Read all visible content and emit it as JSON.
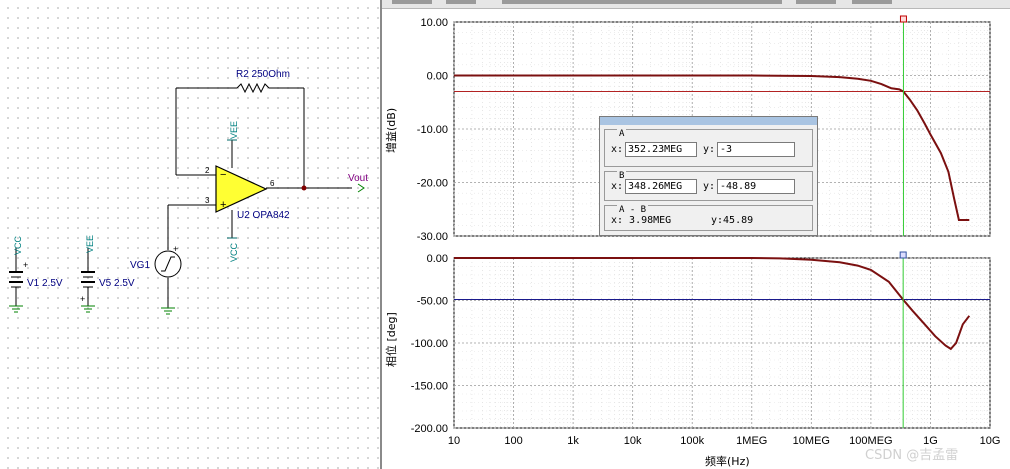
{
  "schematic": {
    "r2_label": "R2 250Ohm",
    "u2_label": "U2 OPA842",
    "vee_top": "VEE",
    "vcc_bottom": "VCC",
    "vout_label": "Vout",
    "pin2": "2",
    "pin3": "3",
    "pin6": "6",
    "vg1_label": "VG1",
    "v1_label": "V1 2.5V",
    "v1_net": "VCC",
    "v5_label": "V5 2.5V",
    "v5_net": "VEE"
  },
  "analyzer": {
    "gain_ylabel": "增益(dB)",
    "phase_ylabel": "相位 [deg]",
    "xlabel": "频率(Hz)",
    "watermark": "CSDN @吉孟雷",
    "gain_ticks": [
      "10.00",
      "0.00",
      "-10.00",
      "-20.00",
      "-30.00"
    ],
    "phase_ticks": [
      "0.00",
      "-50.00",
      "-100.00",
      "-150.00",
      "-200.00"
    ],
    "x_ticks": [
      "10",
      "100",
      "1k",
      "10k",
      "100k",
      "1MEG",
      "10MEG",
      "100MEG",
      "1G",
      "10G"
    ]
  },
  "cursor_box": {
    "a_label": "A",
    "a_x_label": "x:",
    "a_x": "352.23MEG",
    "a_y_label": "y:",
    "a_y": "-3",
    "b_label": "B",
    "b_x_label": "x:",
    "b_x": "348.26MEG",
    "b_y_label": "y:",
    "b_y": "-48.89",
    "diff_label": "A - B",
    "diff_x": "x: 3.98MEG",
    "diff_y": "y:45.89"
  },
  "chart_data": [
    {
      "type": "line",
      "ylabel": "增益(dB)",
      "xlabel": "",
      "x_scale": "log",
      "xlim": [
        10,
        10000000000
      ],
      "ylim": [
        -30,
        10
      ],
      "grid": true,
      "series": [
        {
          "x": [
            10,
            1000000,
            10000000,
            30000000,
            60000000,
            100000000,
            150000000,
            220000000,
            300000000,
            352000000,
            450000000,
            600000000,
            800000000,
            1000000000,
            1500000000,
            2000000000,
            2500000000,
            3000000000,
            4500000000
          ],
          "y": [
            0,
            0,
            -0.1,
            -0.3,
            -0.6,
            -1.0,
            -1.6,
            -2.4,
            -2.6,
            -3.0,
            -4.5,
            -6.5,
            -9.0,
            -11.0,
            -14.5,
            -18.0,
            -23.0,
            -27.0,
            -27.0
          ]
        }
      ],
      "reference_lines": [
        {
          "axis": "y",
          "value": -3,
          "color": "#b22222"
        }
      ],
      "cursor_x": 352230000,
      "colors": {
        "trace": "#7b1010",
        "cursor": "#33cc33"
      }
    },
    {
      "type": "line",
      "ylabel": "相位 [deg]",
      "xlabel": "频率(Hz)",
      "x_scale": "log",
      "xlim": [
        10,
        10000000000
      ],
      "ylim": [
        -200,
        0
      ],
      "grid": true,
      "series": [
        {
          "x": [
            10,
            1000000,
            3000000,
            10000000,
            30000000,
            60000000,
            100000000,
            200000000,
            348000000,
            500000000,
            800000000,
            1200000000,
            1800000000,
            2200000000,
            2700000000,
            3500000000,
            4500000000
          ],
          "y": [
            0,
            0,
            -0.5,
            -2,
            -5,
            -9,
            -14,
            -28,
            -49,
            -62,
            -78,
            -92,
            -103,
            -107,
            -100,
            -78,
            -68
          ]
        }
      ],
      "reference_lines": [
        {
          "axis": "y",
          "value": -48.89,
          "color": "#1a1a8c"
        }
      ],
      "cursor_x": 348260000,
      "colors": {
        "trace": "#7b1010",
        "cursor": "#33cc33"
      }
    }
  ]
}
